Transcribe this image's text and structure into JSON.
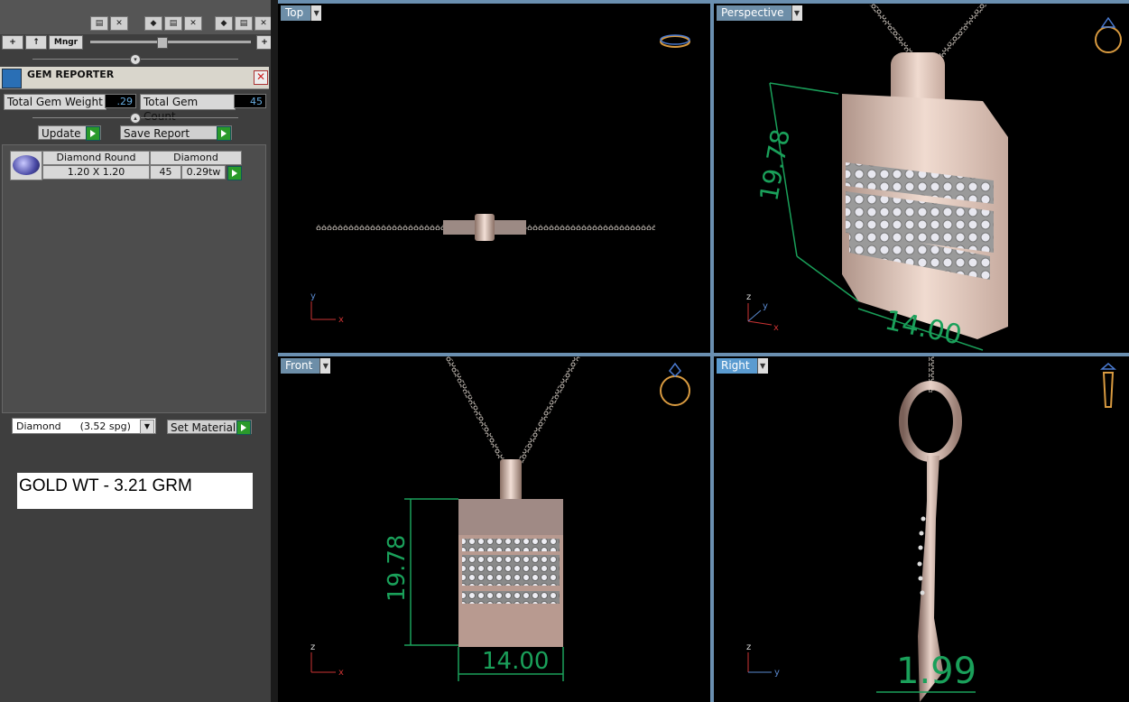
{
  "toolbar": {
    "add_label": "+",
    "up_label": "↑",
    "mngr_label": "Mngr",
    "plus_right": "+"
  },
  "gem_reporter": {
    "title": "GEM REPORTER",
    "total_weight_label": "Total Gem Weight",
    "total_weight_value": ".29",
    "total_count_label": "Total Gem Count",
    "total_count_value": "45",
    "update_label": "Update",
    "save_report_label": "Save Report",
    "gems": [
      {
        "shape": "Diamond Round",
        "size": "1.20 X 1.20",
        "material": "Diamond",
        "count": "45",
        "weight": "0.29tw"
      }
    ],
    "material_select": "Diamond      (3.52 spg)",
    "set_material_label": "Set Material"
  },
  "note": {
    "gold_weight": "GOLD WT - 3.21 GRM"
  },
  "viewports": {
    "top": {
      "label": "Top"
    },
    "perspective": {
      "label": "Perspective",
      "dim_height": "19.78",
      "dim_width": "14.00"
    },
    "front": {
      "label": "Front",
      "dim_height": "19.78",
      "dim_width": "14.00"
    },
    "right": {
      "label": "Right",
      "dim_depth": "1.99"
    }
  },
  "axes": {
    "x": "x",
    "y": "y",
    "z": "z"
  },
  "colors": {
    "dimension": "#1aa05a",
    "metal": "#d9b7a8",
    "accent": "#5a9bd0"
  }
}
